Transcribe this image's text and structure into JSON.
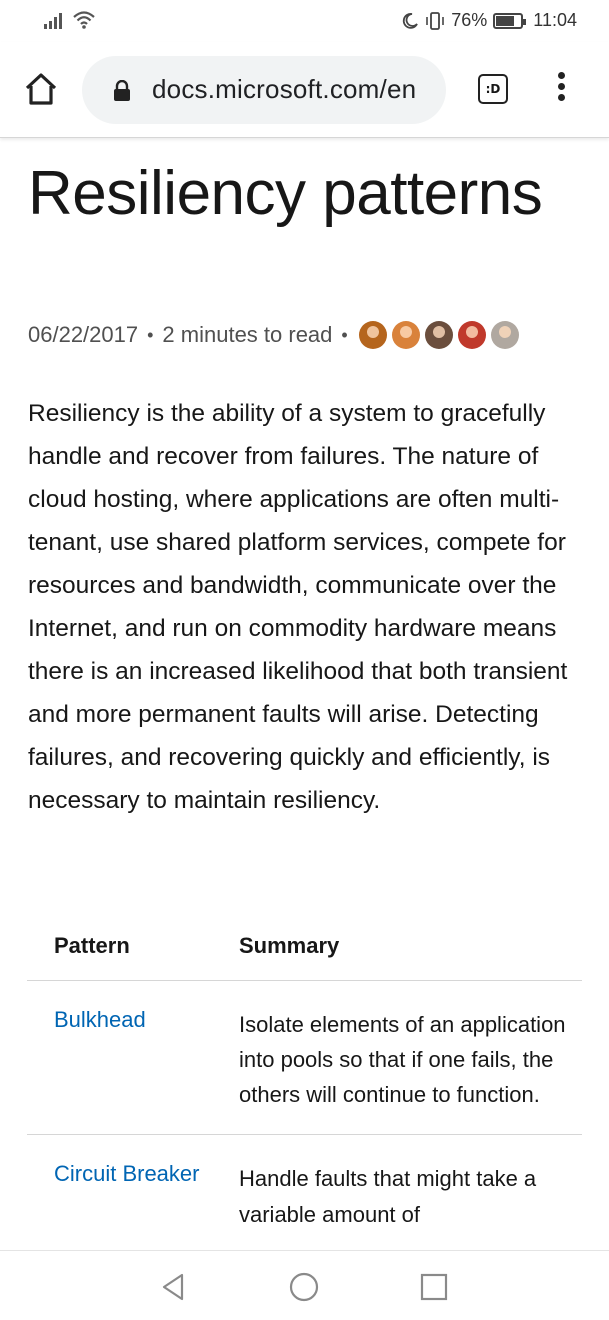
{
  "status_bar": {
    "battery": "76%",
    "battery_level": 0.76,
    "time": "11:04"
  },
  "browser": {
    "url": "docs.microsoft.com/en",
    "tab_switcher_label": ":D"
  },
  "article": {
    "title": "Resiliency patterns",
    "date": "06/22/2017",
    "read_time": "2 minutes to read",
    "contributor_colors": [
      "#b5651d",
      "#d9823b",
      "#6b4e3d",
      "#c0392b",
      "#b0a8a0"
    ],
    "intro": "Resiliency is the ability of a system to gracefully handle and recover from failures. The nature of cloud hosting, where applications are often multi-tenant, use shared platform services, compete for resources and bandwidth, communicate over the Internet, and run on commodity hardware means there is an increased likelihood that both transient and more permanent faults will arise. Detecting failures, and recovering quickly and efficiently, is necessary to maintain resiliency."
  },
  "table": {
    "headers": [
      "Pattern",
      "Summary"
    ],
    "rows": [
      {
        "pattern": "Bulkhead",
        "summary": "Isolate elements of an application into pools so that if one fails, the others will continue to function."
      },
      {
        "pattern": "Circuit Breaker",
        "summary": "Handle faults that might take a variable amount of"
      }
    ]
  },
  "colors": {
    "link": "#0065b3",
    "text": "#171717",
    "url_bar_bg": "#f1f3f4"
  }
}
